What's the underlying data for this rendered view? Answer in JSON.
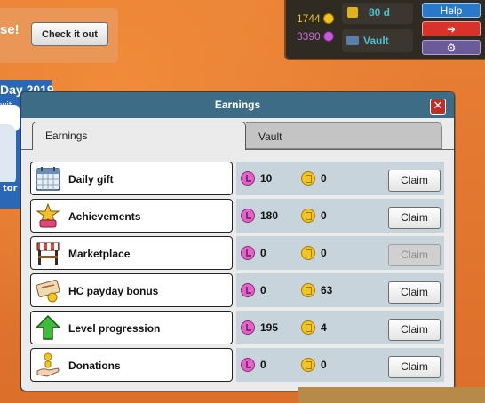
{
  "promo": {
    "text": "se!",
    "button_label": "Check it out"
  },
  "side_banner": {
    "title": "Day 2019",
    "line1": "wit",
    "line2": "nly",
    "footer": "tor"
  },
  "hud": {
    "credits": "1744",
    "diamonds": "3390",
    "hc_days": "80 d",
    "vault_label": "Vault",
    "help_label": "Help",
    "colors": {
      "help": "#2a78c8",
      "exit": "#d9322b",
      "settings": "#6a5a9a"
    }
  },
  "dialog": {
    "title": "Earnings",
    "close_glyph": "✕",
    "tabs": [
      "Earnings",
      "Vault"
    ],
    "active_tab": "Earnings",
    "rows": [
      {
        "label": "Daily gift",
        "icon": "calendar-icon",
        "diamonds": "10",
        "credits": "0",
        "claim": "Claim",
        "enabled": true
      },
      {
        "label": "Achievements",
        "icon": "trophy-icon",
        "diamonds": "180",
        "credits": "0",
        "claim": "Claim",
        "enabled": true
      },
      {
        "label": "Marketplace",
        "icon": "market-stall-icon",
        "diamonds": "0",
        "credits": "0",
        "claim": "Claim",
        "enabled": false
      },
      {
        "label": "HC payday bonus",
        "icon": "payday-icon",
        "diamonds": "0",
        "credits": "63",
        "claim": "Claim",
        "enabled": true
      },
      {
        "label": "Level progression",
        "icon": "level-up-arrow-icon",
        "diamonds": "195",
        "credits": "4",
        "claim": "Claim",
        "enabled": true
      },
      {
        "label": "Donations",
        "icon": "donation-hand-icon",
        "diamonds": "0",
        "credits": "0",
        "claim": "Claim",
        "enabled": true
      }
    ]
  }
}
